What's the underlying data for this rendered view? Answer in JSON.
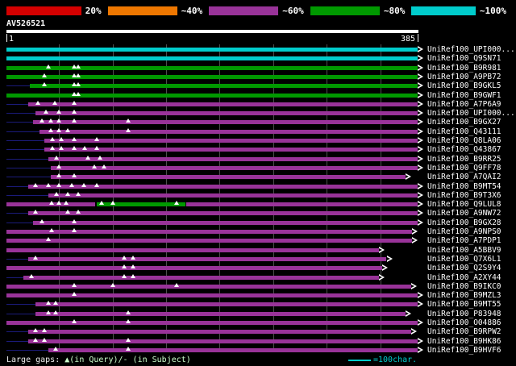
{
  "scale_legend": [
    {
      "label": "20%",
      "color": "#d40000"
    },
    {
      "label": "~40%",
      "color": "#ee7700"
    },
    {
      "label": "~60%",
      "color": "#993399"
    },
    {
      "label": "~80%",
      "color": "#009900"
    },
    {
      "label": "~100%",
      "color": "#00cccc"
    }
  ],
  "ruler": {
    "start_label": "1",
    "end_label": "385"
  },
  "footer": {
    "gaps_label": "Large gaps:",
    "gaps_detail": "▲(in Query)/- (in Subject)",
    "scale_label": "=100char."
  },
  "chart_data": {
    "type": "alignment-map",
    "query_name": "AV526521",
    "query_length": 385,
    "grid_interval": 50,
    "tier_colors": {
      "c20": "#d40000",
      "c40": "#ee7700",
      "c60": "#993399",
      "c80": "#009900",
      "c100": "#00cccc"
    },
    "rows": [
      {
        "label": "UniRef100_UPI000...",
        "segments": [
          {
            "start": 1,
            "end": 385,
            "tier": "c100"
          }
        ],
        "gaps": [],
        "arrow": true,
        "lead": false
      },
      {
        "label": "UniRef100_Q9SN71",
        "segments": [
          {
            "start": 1,
            "end": 385,
            "tier": "c100"
          }
        ],
        "gaps": [],
        "arrow": true,
        "lead": false
      },
      {
        "label": "UniRef100_B9R981",
        "segments": [
          {
            "start": 1,
            "end": 385,
            "tier": "c80"
          }
        ],
        "gaps": [
          40,
          64,
          68
        ],
        "arrow": true,
        "lead": false
      },
      {
        "label": "UniRef100_A9PB72",
        "segments": [
          {
            "start": 1,
            "end": 385,
            "tier": "c80"
          }
        ],
        "gaps": [
          36,
          64,
          68
        ],
        "arrow": true,
        "lead": false
      },
      {
        "label": "UniRef100_B9GKL5",
        "segments": [
          {
            "start": 23,
            "end": 385,
            "tier": "c80"
          }
        ],
        "gaps": [
          36,
          64,
          68
        ],
        "arrow": true,
        "lead": true
      },
      {
        "label": "UniRef100_B9GWF1",
        "segments": [
          {
            "start": 1,
            "end": 385,
            "tier": "c80"
          }
        ],
        "gaps": [
          64,
          68
        ],
        "arrow": true,
        "lead": false
      },
      {
        "label": "UniRef100_A7P6A9",
        "segments": [
          {
            "start": 21,
            "end": 385,
            "tier": "c60"
          }
        ],
        "gaps": [
          30,
          46,
          64
        ],
        "arrow": true,
        "lead": true
      },
      {
        "label": "UniRef100_UPI000...",
        "segments": [
          {
            "start": 28,
            "end": 385,
            "tier": "c60"
          }
        ],
        "gaps": [
          38,
          50,
          64
        ],
        "arrow": true,
        "lead": true
      },
      {
        "label": "UniRef100_B9GX27",
        "segments": [
          {
            "start": 26,
            "end": 385,
            "tier": "c60"
          }
        ],
        "gaps": [
          34,
          42,
          50,
          64,
          115
        ],
        "arrow": true,
        "lead": true
      },
      {
        "label": "UniRef100_Q43111",
        "segments": [
          {
            "start": 32,
            "end": 385,
            "tier": "c60"
          }
        ],
        "gaps": [
          42,
          50,
          58,
          115
        ],
        "arrow": true,
        "lead": true
      },
      {
        "label": "UniRef100_Q8LA06",
        "segments": [
          {
            "start": 36,
            "end": 385,
            "tier": "c60"
          }
        ],
        "gaps": [
          44,
          52,
          64,
          85
        ],
        "arrow": true,
        "lead": true
      },
      {
        "label": "UniRef100_Q43867",
        "segments": [
          {
            "start": 36,
            "end": 385,
            "tier": "c60"
          }
        ],
        "gaps": [
          44,
          52,
          64,
          74,
          85
        ],
        "arrow": true,
        "lead": true
      },
      {
        "label": "UniRef100_B9RR25",
        "segments": [
          {
            "start": 40,
            "end": 385,
            "tier": "c60"
          }
        ],
        "gaps": [
          48,
          77,
          88
        ],
        "arrow": true,
        "lead": true
      },
      {
        "label": "UniRef100_Q9FF78",
        "segments": [
          {
            "start": 42,
            "end": 385,
            "tier": "c60"
          }
        ],
        "gaps": [
          50,
          83,
          92
        ],
        "arrow": true,
        "lead": true
      },
      {
        "label": "UniRef100_A7QAI2",
        "segments": [
          {
            "start": 42,
            "end": 374,
            "tier": "c60"
          }
        ],
        "gaps": [
          50,
          64
        ],
        "arrow": true,
        "lead": true
      },
      {
        "label": "UniRef100_B9MT54",
        "segments": [
          {
            "start": 21,
            "end": 385,
            "tier": "c60"
          }
        ],
        "gaps": [
          28,
          40,
          50,
          62,
          73,
          85
        ],
        "arrow": true,
        "lead": true
      },
      {
        "label": "UniRef100_B9T3X6",
        "segments": [
          {
            "start": 40,
            "end": 385,
            "tier": "c60"
          }
        ],
        "gaps": [
          48,
          58,
          68
        ],
        "arrow": true,
        "lead": true
      },
      {
        "label": "UniRef100_Q9LUL8",
        "segments": [
          {
            "start": 1,
            "end": 84,
            "tier": "c60"
          },
          {
            "start": 85,
            "end": 168,
            "tier": "c80"
          },
          {
            "start": 169,
            "end": 385,
            "tier": "c60"
          }
        ],
        "gaps": [
          43,
          50,
          57,
          90,
          100,
          160
        ],
        "arrow": true,
        "lead": false
      },
      {
        "label": "UniRef100_A9NW72",
        "segments": [
          {
            "start": 21,
            "end": 385,
            "tier": "c60"
          }
        ],
        "gaps": [
          28,
          58,
          68
        ],
        "arrow": true,
        "lead": true
      },
      {
        "label": "UniRef100_B9GX28",
        "segments": [
          {
            "start": 26,
            "end": 385,
            "tier": "c60"
          }
        ],
        "gaps": [
          34,
          64
        ],
        "arrow": true,
        "lead": true
      },
      {
        "label": "UniRef100_A9NPS0",
        "segments": [
          {
            "start": 1,
            "end": 380,
            "tier": "c60"
          }
        ],
        "gaps": [
          43,
          64
        ],
        "arrow": true,
        "lead": false
      },
      {
        "label": "UniRef100_A7PDP1",
        "segments": [
          {
            "start": 1,
            "end": 380,
            "tier": "c60"
          }
        ],
        "gaps": [
          40
        ],
        "arrow": true,
        "lead": false
      },
      {
        "label": "UniRef100_A5BBV9",
        "segments": [
          {
            "start": 1,
            "end": 349,
            "tier": "c60"
          }
        ],
        "gaps": [],
        "arrow": true,
        "lead": false
      },
      {
        "label": "UniRef100_Q7X6L1",
        "segments": [
          {
            "start": 21,
            "end": 356,
            "tier": "c60"
          }
        ],
        "gaps": [
          28,
          111,
          119
        ],
        "arrow": true,
        "lead": true
      },
      {
        "label": "UniRef100_Q2S9Y4",
        "segments": [
          {
            "start": 1,
            "end": 352,
            "tier": "c60"
          }
        ],
        "gaps": [
          111,
          119
        ],
        "arrow": true,
        "lead": false
      },
      {
        "label": "UniRef100_A2XY44",
        "segments": [
          {
            "start": 17,
            "end": 349,
            "tier": "c60"
          }
        ],
        "gaps": [
          24,
          111,
          119
        ],
        "arrow": true,
        "lead": true
      },
      {
        "label": "UniRef100_B9IKC0",
        "segments": [
          {
            "start": 1,
            "end": 379,
            "tier": "c60"
          }
        ],
        "gaps": [
          64,
          100,
          160
        ],
        "arrow": true,
        "lead": false
      },
      {
        "label": "UniRef100_B9MZL3",
        "segments": [
          {
            "start": 1,
            "end": 385,
            "tier": "c60"
          }
        ],
        "gaps": [
          64
        ],
        "arrow": true,
        "lead": false
      },
      {
        "label": "UniRef100_B9MT55",
        "segments": [
          {
            "start": 28,
            "end": 385,
            "tier": "c60"
          }
        ],
        "gaps": [
          40,
          47
        ],
        "arrow": true,
        "lead": true
      },
      {
        "label": "UniRef100_P83948",
        "segments": [
          {
            "start": 28,
            "end": 374,
            "tier": "c60"
          }
        ],
        "gaps": [
          40,
          47,
          115
        ],
        "arrow": true,
        "lead": true
      },
      {
        "label": "UniRef100_O04886",
        "segments": [
          {
            "start": 1,
            "end": 385,
            "tier": "c60"
          }
        ],
        "gaps": [
          64,
          115
        ],
        "arrow": true,
        "lead": false
      },
      {
        "label": "UniRef100_B9RPW2",
        "segments": [
          {
            "start": 21,
            "end": 379,
            "tier": "c60"
          }
        ],
        "gaps": [
          28,
          36
        ],
        "arrow": true,
        "lead": true
      },
      {
        "label": "UniRef100_B9HK86",
        "segments": [
          {
            "start": 21,
            "end": 385,
            "tier": "c60"
          }
        ],
        "gaps": [
          28,
          36,
          115
        ],
        "arrow": true,
        "lead": true
      },
      {
        "label": "UniRef100_B9HVF6",
        "segments": [
          {
            "start": 40,
            "end": 385,
            "tier": "c60"
          }
        ],
        "gaps": [
          47,
          115
        ],
        "arrow": true,
        "lead": true
      }
    ]
  }
}
